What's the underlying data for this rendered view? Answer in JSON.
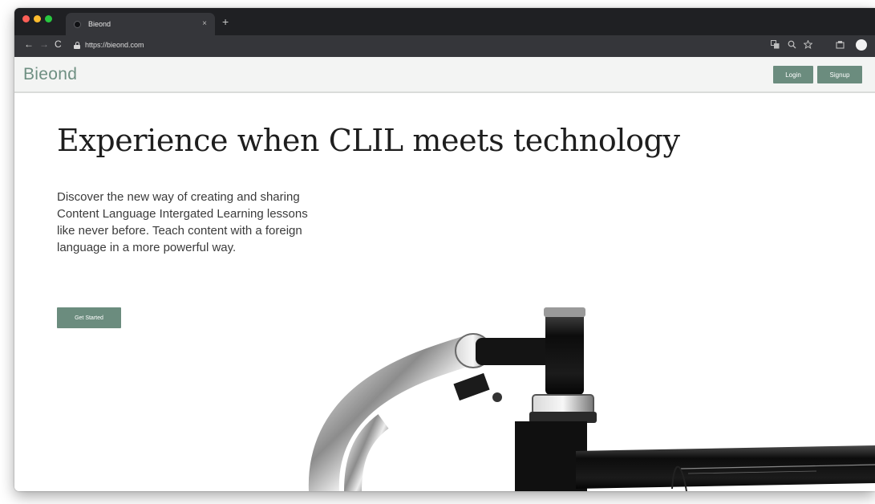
{
  "browser": {
    "tab_title": "Bieond",
    "tab_close": "×",
    "new_tab": "+",
    "url": "https://bieond.com",
    "nav": {
      "back": "←",
      "forward": "→",
      "reload": "C"
    },
    "icons": [
      "translate-icon",
      "zoom-icon",
      "star-icon",
      "extension-icon",
      "profile-avatar"
    ]
  },
  "site": {
    "logo": "Bieond",
    "login_label": "Login",
    "signup_label": "Signup",
    "accent_color": "#6b8c7e"
  },
  "hero": {
    "title": "Experience when CLIL meets technology",
    "description": "Discover the new way of creating and sharing Content Language Intergated Learning lessons like never before. Teach content with a foreign language in a more powerful way.",
    "cta_label": "Get Started",
    "image": "bicycle-handlebar-photo"
  }
}
